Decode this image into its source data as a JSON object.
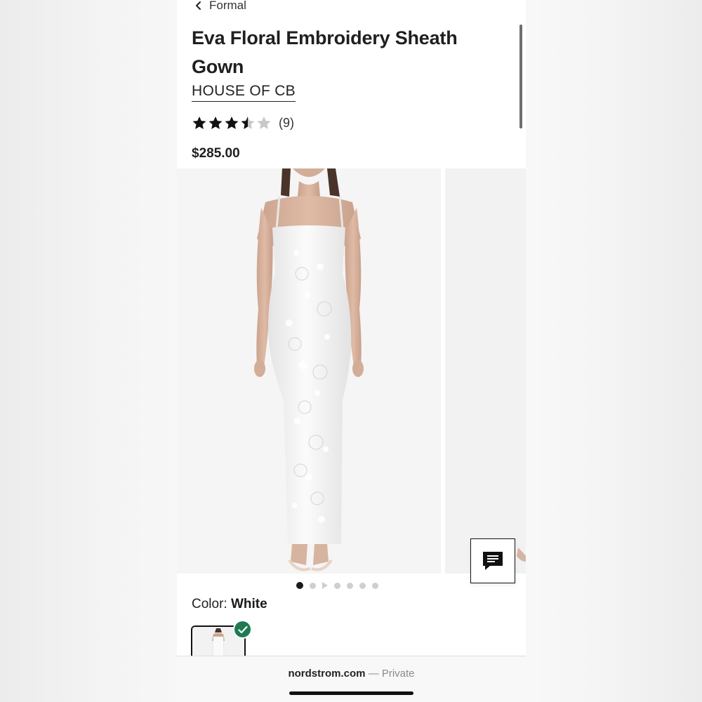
{
  "breadcrumb": {
    "back_label": "Formal"
  },
  "product": {
    "title": "Eva Floral Embroidery Sheath Gown",
    "brand": "HOUSE OF CB",
    "rating": 3.5,
    "rating_max": 5,
    "review_count": "(9)",
    "price": "$285.00"
  },
  "gallery": {
    "image_count": 7,
    "active_index": 0,
    "video_index": 2
  },
  "color": {
    "label": "Color: ",
    "value": "White"
  },
  "browser": {
    "domain": "nordstrom.com",
    "mode": " — Private"
  },
  "colors": {
    "check_badge": "#1f7a52",
    "star_filled": "#111111",
    "star_empty": "#c8c8c8"
  }
}
